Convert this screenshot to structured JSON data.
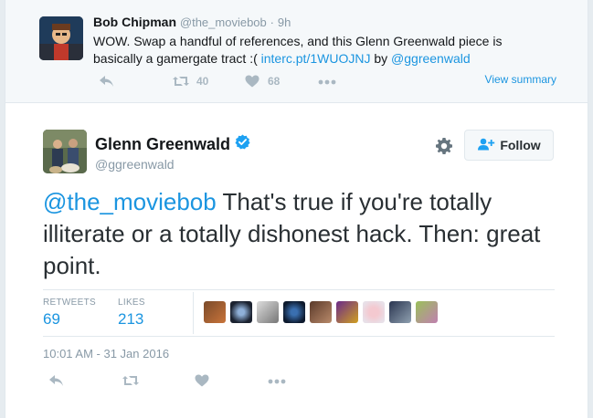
{
  "context_tweet": {
    "name": "Bob Chipman",
    "handle": "@the_moviebob",
    "dot": "·",
    "time": "9h",
    "text_before": "WOW. Swap a handful of references, and this Glenn Greenwald piece is basically a gamergate tract :( ",
    "link": "interc.pt/1WUOJNJ",
    "text_by": " by ",
    "mention": "@ggreenwald",
    "retweets": "40",
    "likes": "68",
    "view_summary": "View summary"
  },
  "tweet": {
    "name": "Glenn Greenwald",
    "handle": "@ggreenwald",
    "follow_label": "Follow",
    "mention": "@the_moviebob",
    "text": " That's true if you're totally illiterate or a totally dishonest hack. Then: great point.",
    "retweets_label": "RETWEETS",
    "retweets": "69",
    "likes_label": "LIKES",
    "likes": "213",
    "timestamp": "10:01 AM - 31 Jan 2016"
  },
  "colors": {
    "link": "#1b95e0",
    "muted": "#8899a6",
    "icon": "#aab8c2",
    "verified": "#1da1f2"
  },
  "icons": [
    "reply-icon",
    "retweet-icon",
    "heart-icon",
    "more-icon",
    "gear-icon",
    "follow-person-icon",
    "verified-badge-icon"
  ]
}
